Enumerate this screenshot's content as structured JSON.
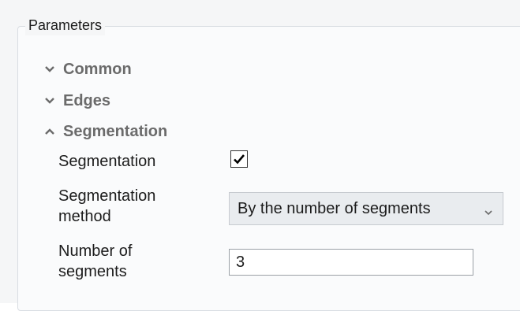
{
  "group": {
    "title": "Parameters"
  },
  "sections": [
    {
      "label": "Common",
      "state": "collapsed",
      "icon": "chevron-down-icon"
    },
    {
      "label": "Edges",
      "state": "collapsed",
      "icon": "chevron-down-icon"
    },
    {
      "label": "Segmentation",
      "state": "expanded",
      "icon": "chevron-up-icon"
    }
  ],
  "segmentation": {
    "enabled_label": "Segmentation",
    "enabled_checked": true,
    "method_label_line1": "Segmentation",
    "method_label_line2": "method",
    "method_value": "By the number of segments",
    "count_label_line1": "Number of",
    "count_label_line2": "segments",
    "count_value": "3"
  },
  "colors": {
    "section_text": "#6b6b6b",
    "panel_bg": "#f5f6f7",
    "select_bg": "#e9ecef"
  }
}
